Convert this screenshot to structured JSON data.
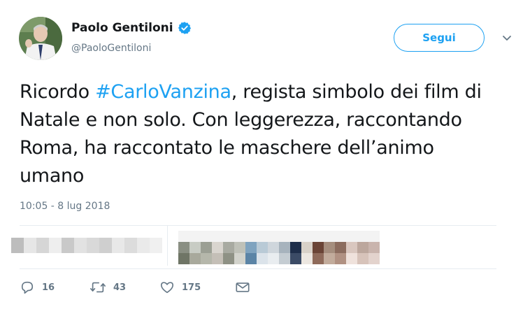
{
  "author": {
    "name": "Paolo Gentiloni",
    "handle": "@PaoloGentiloni",
    "verified_icon": "verified-badge-icon"
  },
  "follow_button": {
    "label": "Segui"
  },
  "tweet": {
    "text_before": "Ricordo ",
    "hashtag": "#CarloVanzina",
    "text_after": ", regista simbolo dei film di Natale e non solo. Con leggerezza, raccontando Roma, ha raccontato le maschere dell’animo umano",
    "timestamp": "10:05 - 8 lug 2018"
  },
  "actions": {
    "replies": "16",
    "retweets": "43",
    "likes": "175"
  },
  "colors": {
    "accent": "#1da1f2",
    "text": "#14171a",
    "muted": "#657786",
    "border": "#e6ecf0"
  },
  "mosaic": {
    "label_colors": [
      "#bdbdbd",
      "#e6e6e6",
      "#d6d6d6",
      "#eeeeee",
      "#c9c9c9",
      "#e2e2e2",
      "#d9d9d9",
      "#cfcfcf",
      "#e8e8e8",
      "#dcdcdc",
      "#eaeaea",
      "#f0f0f0"
    ],
    "avatar_colors": [
      [
        "#8a8f83",
        "#6f7566"
      ],
      [
        "#c8ccc4",
        "#a8a99c"
      ],
      [
        "#9b9f94",
        "#b5b7ab"
      ],
      [
        "#d9d5cf",
        "#c4bfb7"
      ],
      [
        "#a8aaa1",
        "#8e9185"
      ],
      [
        "#bfc1b8",
        "#d2d3cc"
      ],
      [
        "#7fa3bf",
        "#5b84a6"
      ],
      [
        "#b9cad6",
        "#dbe3ea"
      ],
      [
        "#cfd6dc",
        "#e9edf0"
      ],
      [
        "#a7b3bd",
        "#c4ccd2"
      ],
      [
        "#1e2e4a",
        "#3b4b66"
      ],
      [
        "#d8d1c8",
        "#ece7e1"
      ],
      [
        "#6a4436",
        "#8e6a5a"
      ],
      [
        "#a58e7e",
        "#c2ac9c"
      ],
      [
        "#8b6c5e",
        "#b09182"
      ],
      [
        "#d9c7bf",
        "#efe2dc"
      ],
      [
        "#bca79d",
        "#d7c3ba"
      ],
      [
        "#c9b4ad",
        "#e3d3cd"
      ]
    ]
  }
}
